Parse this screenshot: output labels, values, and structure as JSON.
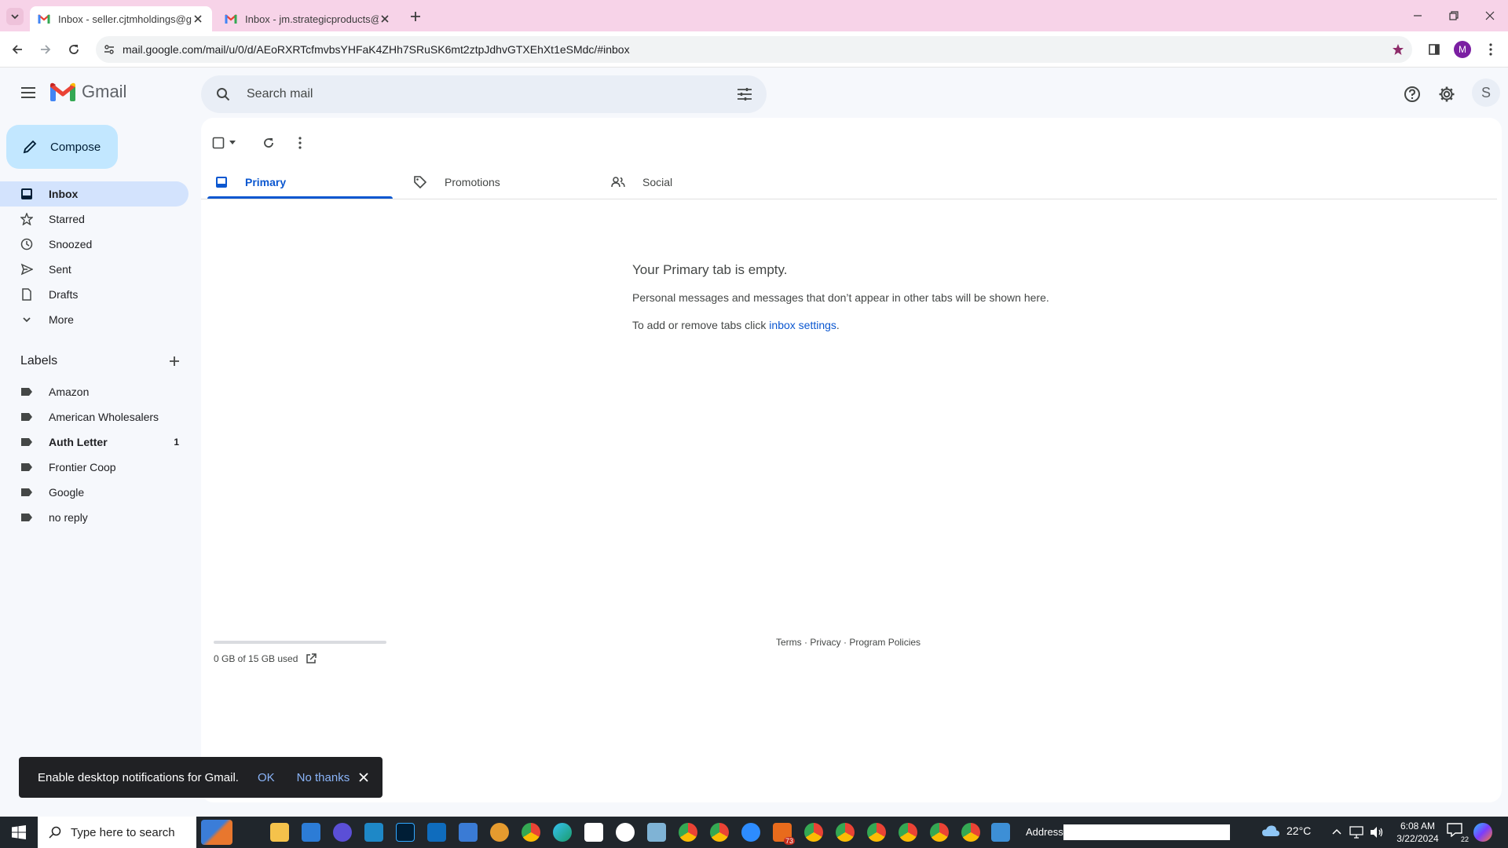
{
  "browser": {
    "tabs": [
      {
        "title": "Inbox - seller.cjtmholdings@gm"
      },
      {
        "title": "Inbox - jm.strategicproducts@g"
      }
    ],
    "url": "mail.google.com/mail/u/0/d/AEoRXRTcfmvbsYHFaK4ZHh7SRuSK6mt2ztpJdhvGTXEhXt1eSMdc/#inbox",
    "profile_initial": "M"
  },
  "gmail": {
    "brand": "Gmail",
    "search_placeholder": "Search mail",
    "account_initial": "S",
    "compose_label": "Compose",
    "nav": [
      {
        "label": "Inbox",
        "icon": "inbox-icon"
      },
      {
        "label": "Starred",
        "icon": "star-icon"
      },
      {
        "label": "Snoozed",
        "icon": "clock-icon"
      },
      {
        "label": "Sent",
        "icon": "send-icon"
      },
      {
        "label": "Drafts",
        "icon": "draft-icon"
      },
      {
        "label": "More",
        "icon": "chevron-down-icon"
      }
    ],
    "labels_heading": "Labels",
    "labels": [
      {
        "name": "Amazon",
        "count": ""
      },
      {
        "name": "American Wholesalers",
        "count": ""
      },
      {
        "name": "Auth Letter",
        "count": "1"
      },
      {
        "name": "Frontier Coop",
        "count": ""
      },
      {
        "name": "Google",
        "count": ""
      },
      {
        "name": "no reply",
        "count": ""
      }
    ],
    "category_tabs": [
      {
        "label": "Primary"
      },
      {
        "label": "Promotions"
      },
      {
        "label": "Social"
      }
    ],
    "empty_state": {
      "title": "Your Primary tab is empty.",
      "line1": "Personal messages and messages that don’t appear in other tabs will be shown here.",
      "line2_prefix": "To add or remove tabs click ",
      "line2_link": "inbox settings",
      "line2_suffix": "."
    },
    "storage": {
      "text": "0 GB of 15 GB used",
      "fraction": 0.0
    },
    "footer": {
      "terms": "Terms",
      "sep1": " · ",
      "privacy": "Privacy",
      "sep2": " · ",
      "policies": "Program Policies"
    },
    "notification": {
      "text": "Enable desktop notifications for Gmail.",
      "ok": "OK",
      "no_thanks": "No thanks"
    }
  },
  "taskbar": {
    "search_placeholder": "Type here to search",
    "address_label": "Address",
    "weather": "22°C",
    "time": "6:08 AM",
    "date": "3/22/2024",
    "notification_count": "22",
    "badge_count": "73"
  },
  "colors": {
    "accent": "#0b57d0",
    "tabstrip": "#f7d3e8",
    "compose": "#c2e7ff",
    "active_nav": "#d3e3fd"
  }
}
